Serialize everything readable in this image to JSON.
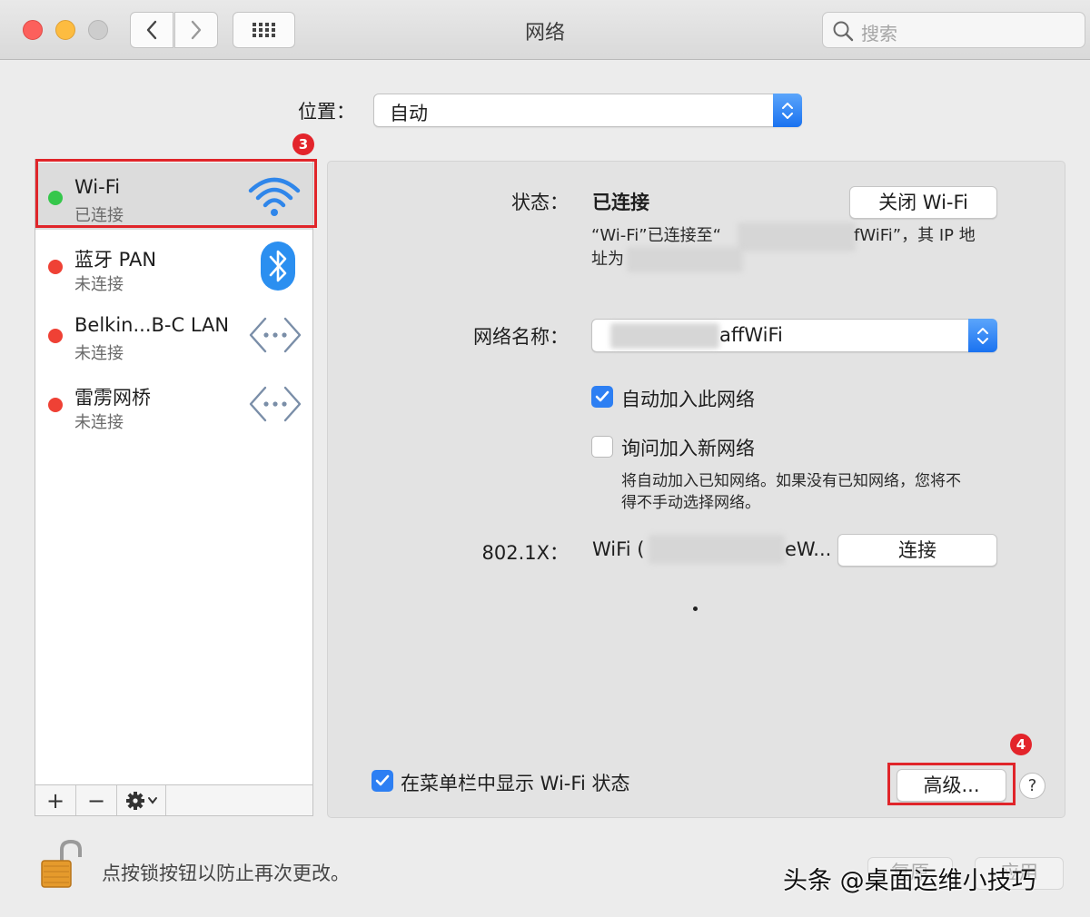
{
  "window": {
    "title": "网络",
    "search_placeholder": "搜索"
  },
  "location": {
    "label": "位置：",
    "value": "自动"
  },
  "services": [
    {
      "name": "Wi-Fi",
      "status": "已连接",
      "color": "#35c74b",
      "icon": "wifi-icon"
    },
    {
      "name": "蓝牙 PAN",
      "status": "未连接",
      "color": "#ef4135",
      "icon": "bluetooth-icon"
    },
    {
      "name": "Belkin...B-C LAN",
      "status": "未连接",
      "color": "#ef4135",
      "icon": "ethernet-icon"
    },
    {
      "name": "雷雳网桥",
      "status": "未连接",
      "color": "#ef4135",
      "icon": "ethernet-icon"
    }
  ],
  "sidebar_toolbar": {
    "add": "+",
    "remove": "−"
  },
  "detail": {
    "status_label": "状态：",
    "status_value": "已连接",
    "turn_off_button": "关闭 Wi-Fi",
    "status_desc_line1_a": "“Wi-Fi”已连接至“",
    "status_desc_line1_b": "fWiFi”，其 IP 地",
    "status_desc_line2": "址为",
    "network_name_label": "网络名称：",
    "network_name_value": "affWiFi",
    "auto_join_label": "自动加入此网络",
    "auto_join_checked": true,
    "ask_join_label": "询问加入新网络",
    "ask_join_checked": false,
    "ask_join_help_line1": "将自动加入已知网络。如果没有已知网络，您将不",
    "ask_join_help_line2": "得不手动选择网络。",
    "dot1x_label": "802.1X：",
    "dot1x_value_a": "WiFi (",
    "dot1x_value_b": "eW...",
    "connect_button": "连接",
    "show_menubar_label": "在菜单栏中显示 Wi-Fi 状态",
    "show_menubar_checked": true,
    "advanced_button": "高级...",
    "help_button": "?"
  },
  "annotations": {
    "badge_3": "3",
    "badge_4": "4",
    "highlight_color": "#e0252a"
  },
  "footer": {
    "lock_text": "点按锁按钮以防止再次更改。",
    "revert_button": "复原",
    "apply_button": "应用",
    "watermark": "头条 @桌面运维小技巧"
  }
}
